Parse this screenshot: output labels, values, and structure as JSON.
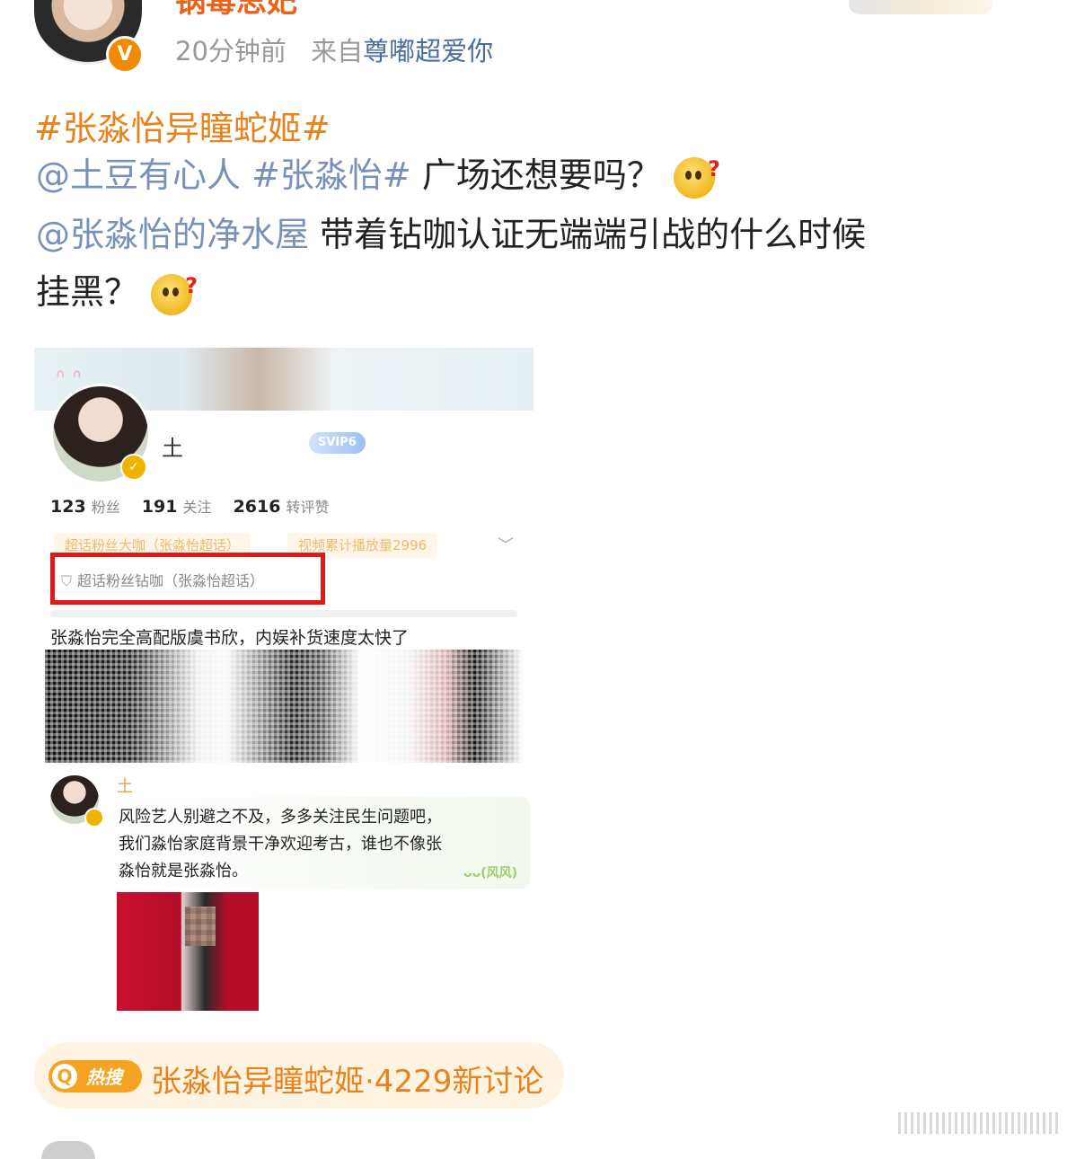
{
  "post": {
    "username": "锅毒思妃",
    "time": "20分钟前",
    "source_prefix": "来自",
    "source": "尊嘟超爱你",
    "hashtag_title": "#张淼怡异瞳蛇姬#",
    "line1_mention": "@土豆有心人 #张淼怡#",
    "line1_text": " 广场还想要吗？",
    "line2_mention": "@张淼怡的净水屋",
    "line2_text": " 带着钻咖认证无端端引战的什么时候",
    "line3_text": "挂黑？"
  },
  "embed": {
    "name": "土",
    "svip": "SVIP6",
    "stats": [
      {
        "num": "123",
        "label": "粉丝"
      },
      {
        "num": "191",
        "label": "关注"
      },
      {
        "num": "2616",
        "label": "转评赞"
      }
    ],
    "tag1": "超话粉丝大咖（张淼怡超话）",
    "tag2": "视频累计播放量2996",
    "diamond_tag": "超话粉丝钻咖（张淼怡超话）",
    "post_text": "张淼怡完全高配版虞书欣，内娱补货速度太快了",
    "comment_user": "土",
    "comment_l1": "风险艺人别避之不及，多多关注民生问题吧，",
    "comment_l2": "我们淼怡家庭背景干净欢迎考古，谁也不像张",
    "comment_l3": "淼怡就是张淼怡。",
    "bubble_decor": "ᴗᴗ(风风)"
  },
  "hot_search": {
    "badge": "热搜",
    "text": "张淼怡异瞳蛇姬·4229新讨论"
  },
  "icons": {
    "verified": "verified-v-icon",
    "emoji": "thinking-question-emoji-icon",
    "search": "search-glass-icon",
    "chevron": "chevron-down-icon"
  },
  "colors": {
    "accent_orange": "#e8821c",
    "mention_blue": "#4a6da0",
    "highlight_red": "#e01919"
  }
}
